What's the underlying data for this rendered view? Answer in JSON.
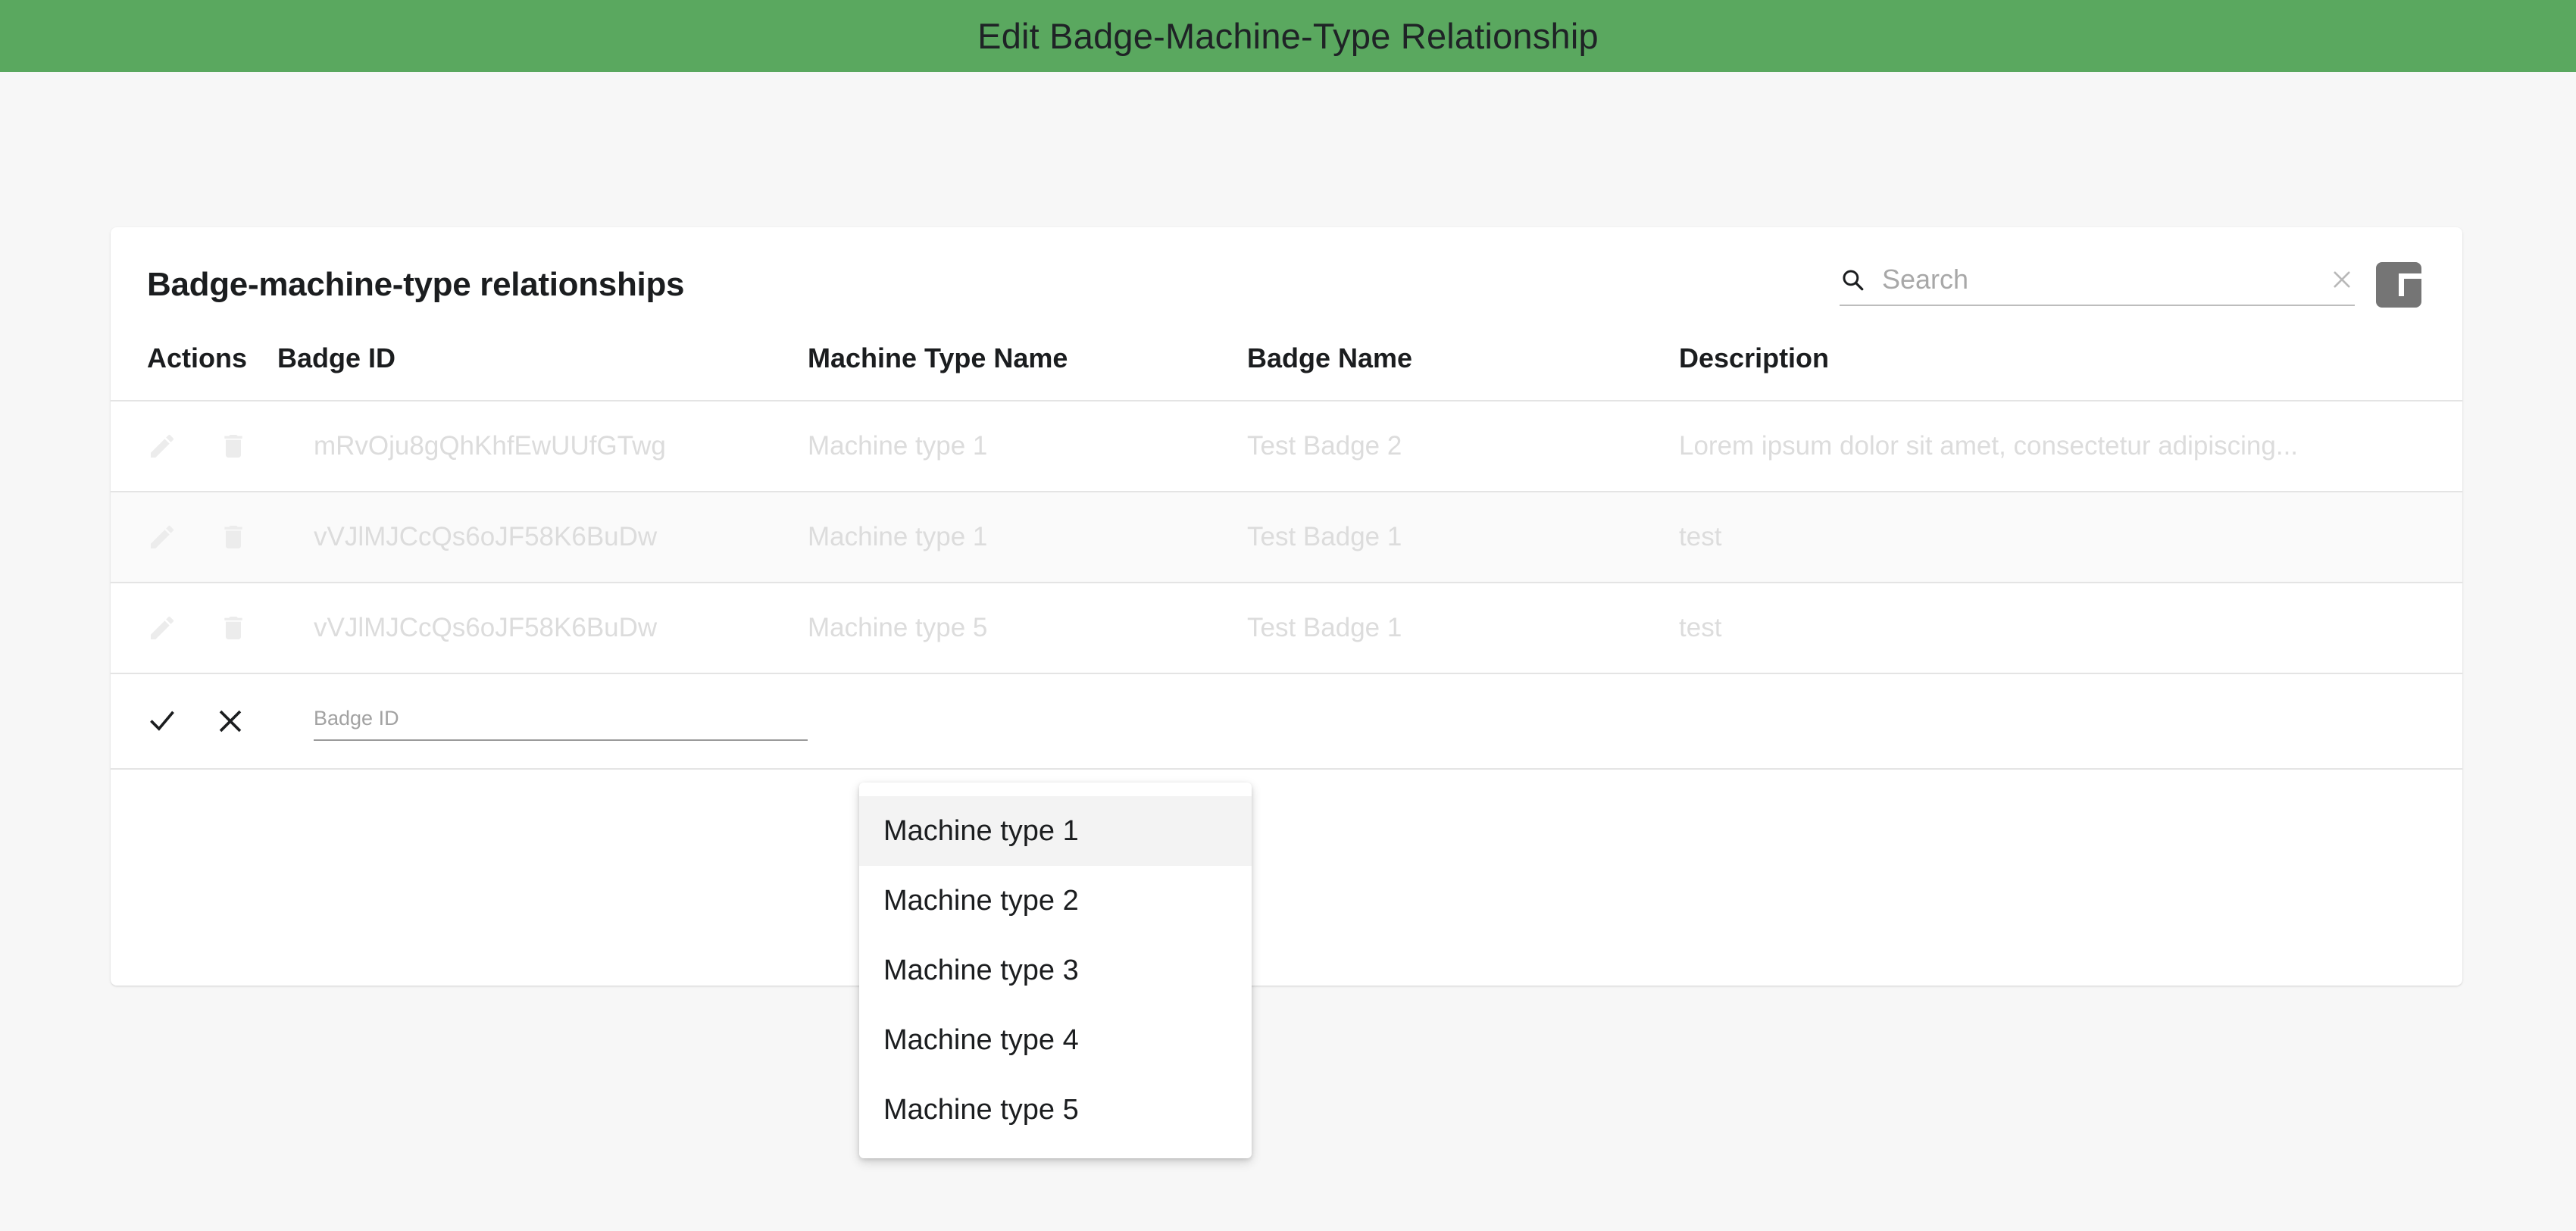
{
  "banner": {
    "title": "Edit Badge-Machine-Type Relationship",
    "color": "#5aa85f"
  },
  "card": {
    "title": "Badge-machine-type relationships"
  },
  "search": {
    "placeholder": "Search",
    "value": "",
    "icon": "search-icon",
    "clear_icon": "close-icon"
  },
  "add_button": {
    "icon": "plus-icon",
    "color": "#757575"
  },
  "table": {
    "columns": [
      "Actions",
      "Badge ID",
      "Machine Type Name",
      "Badge Name",
      "Description"
    ],
    "rows": [
      {
        "badge_id": "mRvOju8gQhKhfEwUUfGTwg",
        "machine_type_name": "Machine type 1",
        "badge_name": "Test Badge 2",
        "description": "Lorem ipsum dolor sit amet, consectetur adipiscing..."
      },
      {
        "badge_id": "vVJlMJCcQs6oJF58K6BuDw",
        "machine_type_name": "Machine type 1",
        "badge_name": "Test Badge 1",
        "description": "test"
      },
      {
        "badge_id": "vVJlMJCcQs6oJF58K6BuDw",
        "machine_type_name": "Machine type 5",
        "badge_name": "Test Badge 1",
        "description": "test"
      }
    ],
    "row_actions": {
      "edit_icon": "pencil-icon",
      "delete_icon": "trash-icon"
    }
  },
  "edit_row": {
    "confirm_icon": "check-icon",
    "cancel_icon": "close-icon",
    "badge_id_placeholder": "Badge ID",
    "badge_id_value": ""
  },
  "dropdown": {
    "options": [
      "Machine type 1",
      "Machine type 2",
      "Machine type 3",
      "Machine type 4",
      "Machine type 5"
    ],
    "active_index": 0
  }
}
